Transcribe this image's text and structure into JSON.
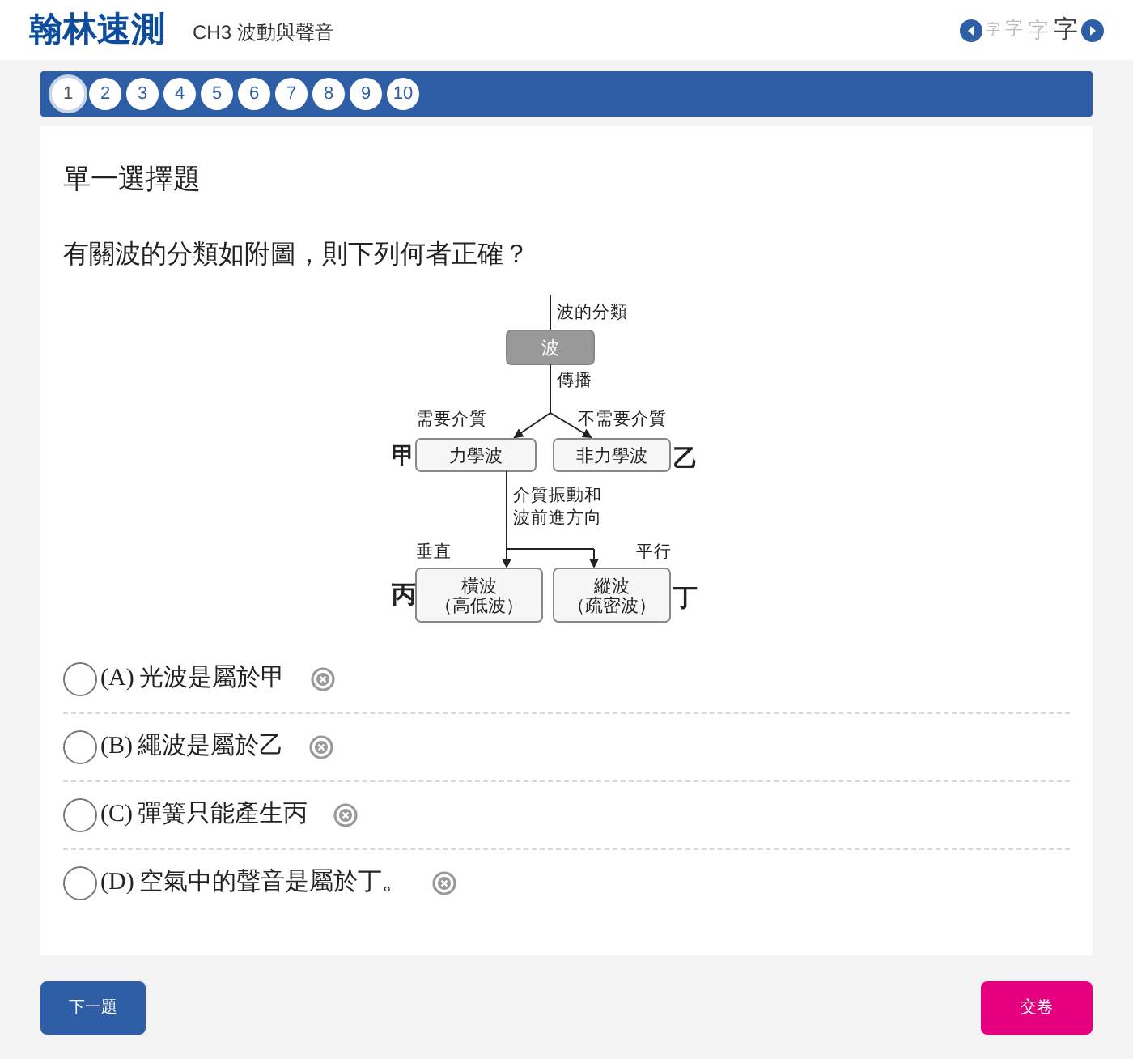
{
  "header": {
    "logo": "翰林速測",
    "chapter": "CH3 波動與聲音",
    "font_sizes": [
      {
        "label": "字",
        "selected": false
      },
      {
        "label": "字",
        "selected": false
      },
      {
        "label": "字",
        "selected": false
      },
      {
        "label": "字",
        "selected": true
      }
    ]
  },
  "question_nav": [
    {
      "label": "1",
      "selected": true
    },
    {
      "label": "2",
      "selected": false
    },
    {
      "label": "3",
      "selected": false
    },
    {
      "label": "4",
      "selected": false
    },
    {
      "label": "5",
      "selected": false
    },
    {
      "label": "6",
      "selected": false
    },
    {
      "label": "7",
      "selected": false
    },
    {
      "label": "8",
      "selected": false
    },
    {
      "label": "9",
      "selected": false
    },
    {
      "label": "10",
      "selected": false
    }
  ],
  "question": {
    "type": "單一選擇題",
    "stem": "有關波的分類如附圖，則下列何者正確？"
  },
  "figure": {
    "title": "波的分類",
    "root": "波",
    "root_edge": "傳播",
    "left_edge": "需要介質",
    "right_edge": "不需要介質",
    "left_node": "力學波",
    "right_node": "非力學波",
    "left_mark": "甲",
    "right_mark": "乙",
    "branch_label": [
      "介質振動和",
      "波前進方向"
    ],
    "bottom_left_edge": "垂直",
    "bottom_right_edge": "平行",
    "bottom_left_node": [
      "橫波",
      "（高低波）"
    ],
    "bottom_right_node": [
      "縱波",
      "（疏密波）"
    ],
    "bottom_left_mark": "丙",
    "bottom_right_mark": "丁"
  },
  "options": [
    {
      "letter": "(A)",
      "text": "光波是屬於甲",
      "selected": false
    },
    {
      "letter": "(B)",
      "text": "繩波是屬於乙",
      "selected": false
    },
    {
      "letter": "(C)",
      "text": "彈簧只能產生丙",
      "selected": false
    },
    {
      "letter": "(D)",
      "text": "空氣中的聲音是屬於丁。",
      "selected": false
    }
  ],
  "buttons": {
    "next": "下一題",
    "submit": "交卷"
  }
}
